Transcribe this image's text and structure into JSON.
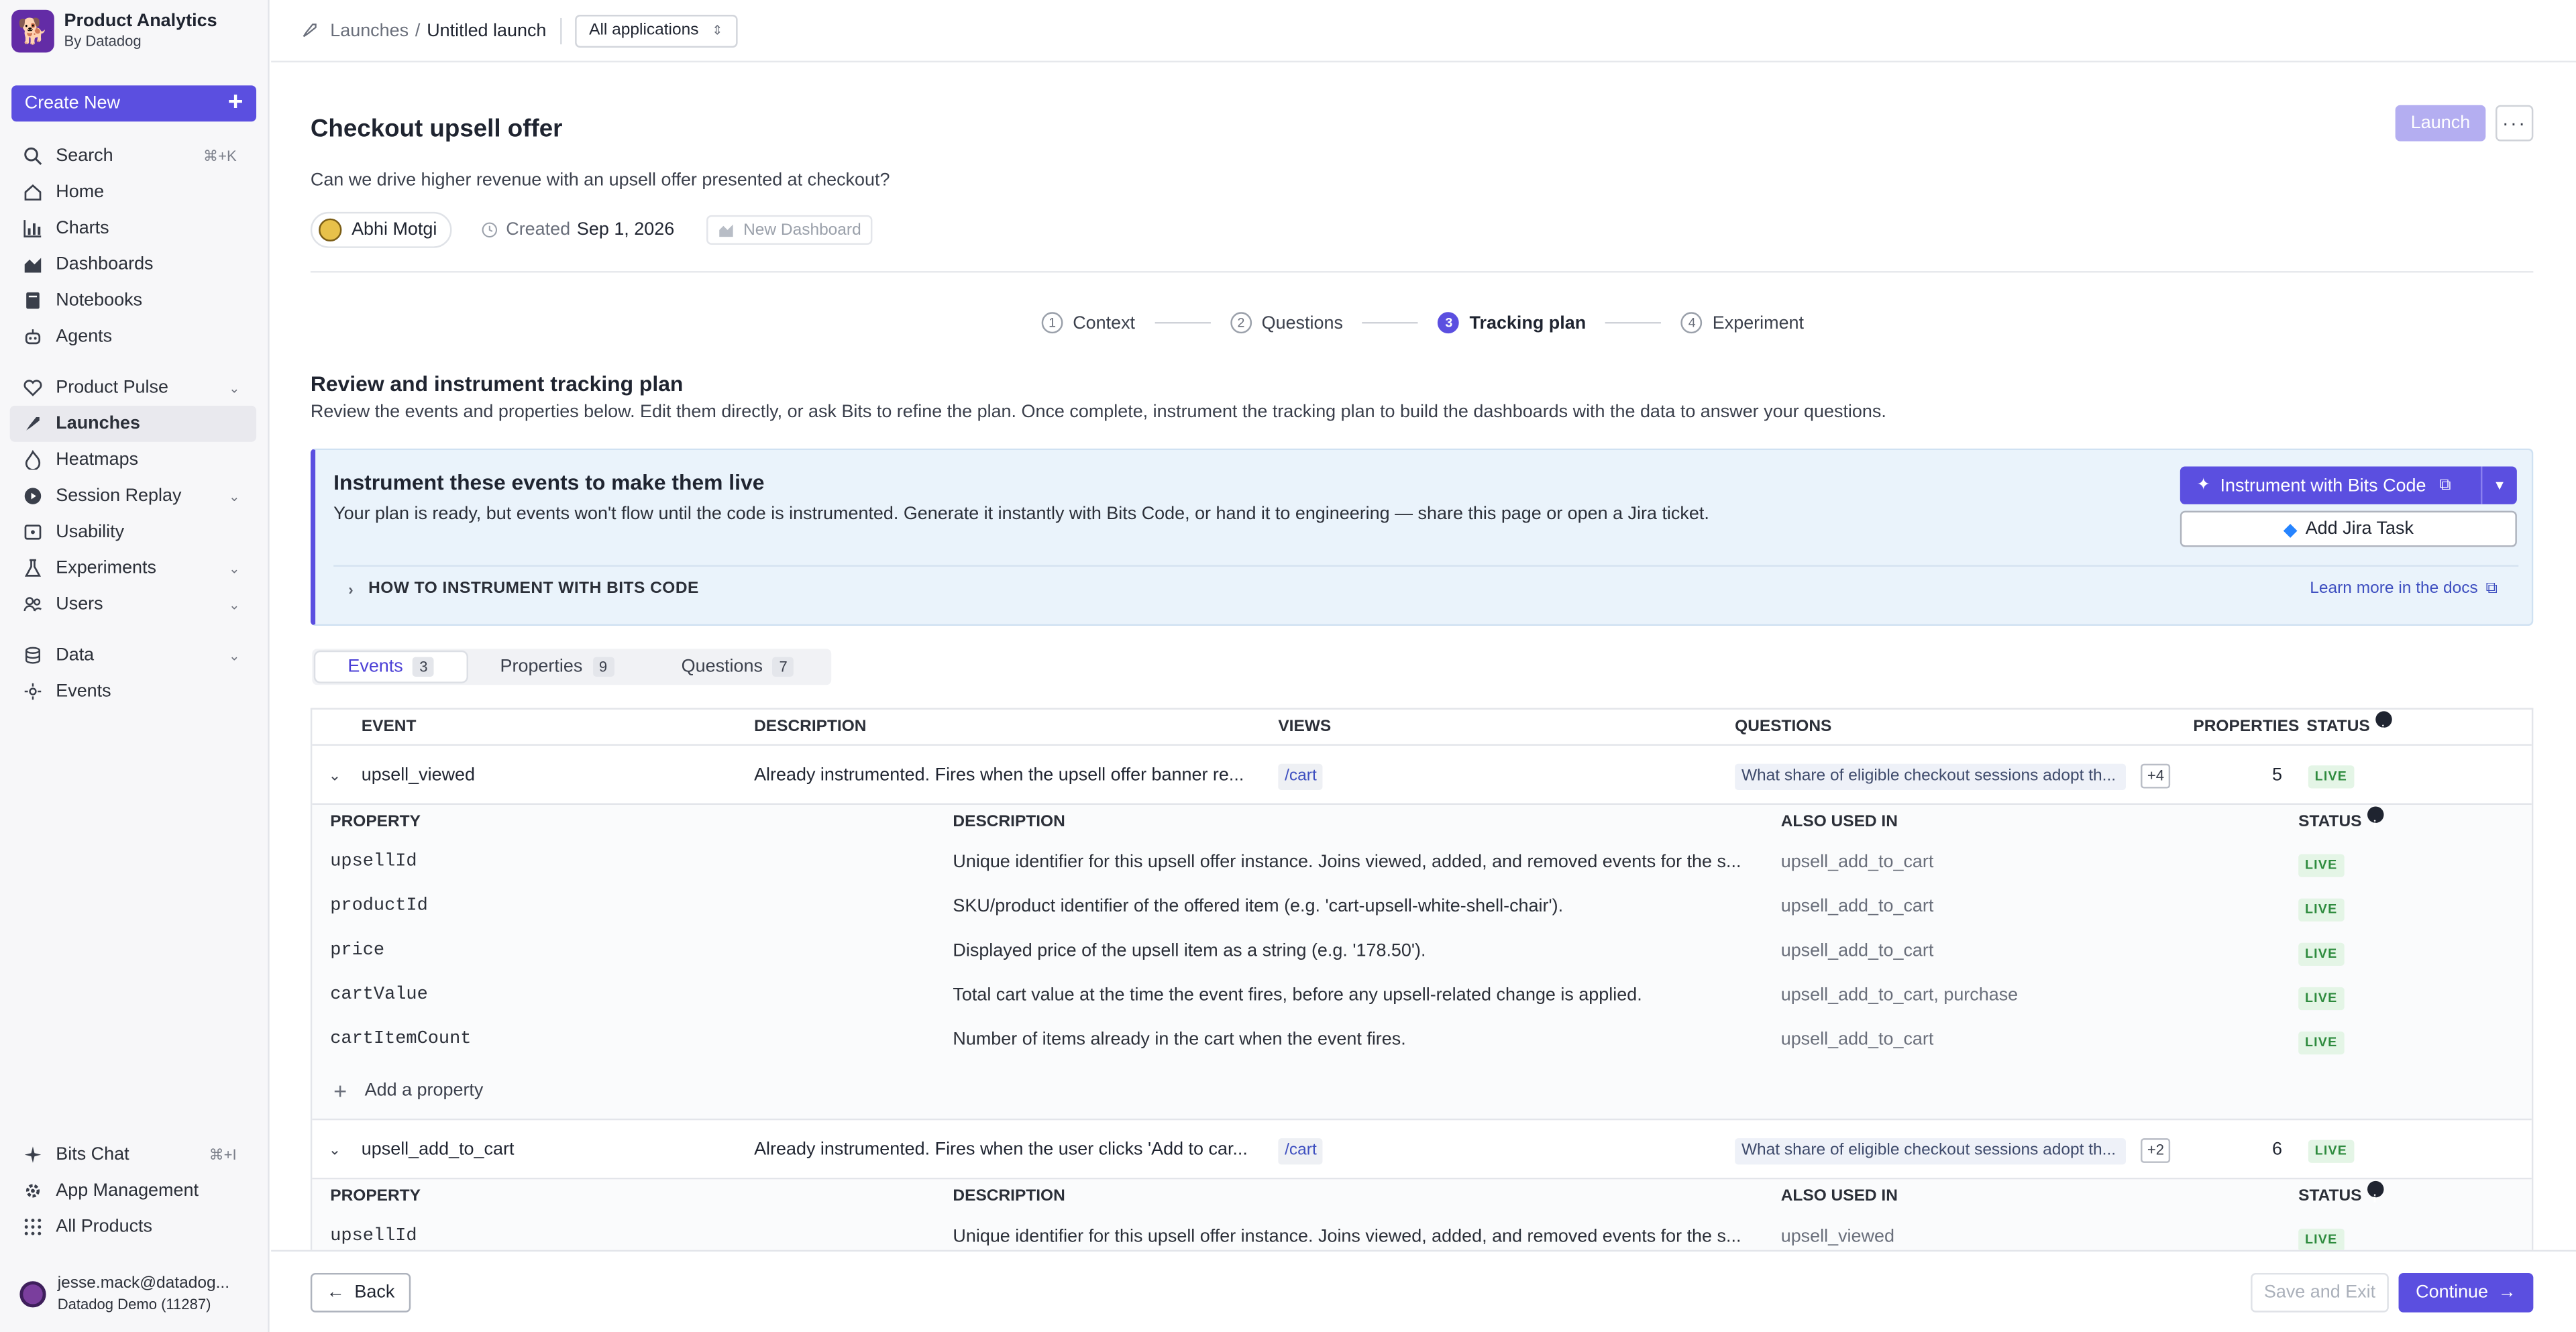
{
  "brand": {
    "title": "Product Analytics",
    "subtitle": "By Datadog"
  },
  "sidebar": {
    "create_label": "Create New",
    "items": [
      {
        "label": "Search",
        "kbd": "⌘+K"
      },
      {
        "label": "Home"
      },
      {
        "label": "Charts"
      },
      {
        "label": "Dashboards"
      },
      {
        "label": "Notebooks"
      },
      {
        "label": "Agents"
      },
      {
        "label": "Product Pulse"
      },
      {
        "label": "Launches"
      },
      {
        "label": "Heatmaps"
      },
      {
        "label": "Session Replay"
      },
      {
        "label": "Usability"
      },
      {
        "label": "Experiments"
      },
      {
        "label": "Users"
      },
      {
        "label": "Data"
      },
      {
        "label": "Events"
      },
      {
        "label": "Bits Chat",
        "kbd": "⌘+I"
      },
      {
        "label": "App Management"
      },
      {
        "label": "All Products"
      }
    ],
    "user_email": "jesse.mack@datadog...",
    "user_org": "Datadog Demo (11287)"
  },
  "topbar": {
    "crumb_parent": "Launches",
    "crumb_sep": "/",
    "crumb_current": "Untitled launch",
    "app_select": "All applications"
  },
  "header": {
    "title": "Checkout upsell offer",
    "launch_label": "Launch",
    "subtitle": "Can we drive higher revenue with an upsell offer presented at checkout?",
    "owner": "Abhi Motgi",
    "created_label": "Created",
    "created_date": "Sep 1, 2026",
    "new_dashboard": "New Dashboard"
  },
  "stepper": [
    {
      "num": "1",
      "label": "Context"
    },
    {
      "num": "2",
      "label": "Questions"
    },
    {
      "num": "3",
      "label": "Tracking plan"
    },
    {
      "num": "4",
      "label": "Experiment"
    }
  ],
  "section": {
    "title": "Review and instrument tracking plan",
    "desc": "Review the events and properties below. Edit them directly, or ask Bits to refine the plan. Once complete, instrument the tracking plan to build the dashboards with the data to answer your questions."
  },
  "banner": {
    "title": "Instrument these events to make them live",
    "desc": "Your plan is ready, but events won't flow until the code is instrumented. Generate it instantly with Bits Code, or hand it to engineering — share this page or open a Jira ticket.",
    "bits_label": "Instrument with Bits Code",
    "jira_label": "Add Jira Task",
    "howto": "HOW TO INSTRUMENT WITH BITS CODE",
    "docs": "Learn more in the docs"
  },
  "tabs": [
    {
      "label": "Events",
      "count": "3"
    },
    {
      "label": "Properties",
      "count": "9"
    },
    {
      "label": "Questions",
      "count": "7"
    }
  ],
  "table": {
    "headers": {
      "event": "EVENT",
      "description": "DESCRIPTION",
      "views": "VIEWS",
      "questions": "QUESTIONS",
      "properties": "PROPERTIES",
      "status": "STATUS"
    },
    "prop_headers": {
      "property": "PROPERTY",
      "description": "DESCRIPTION",
      "also": "ALSO USED IN",
      "status": "STATUS"
    },
    "events": [
      {
        "name": "upsell_viewed",
        "description": "Already instrumented. Fires when the upsell offer banner re...",
        "view": "/cart",
        "question": "What share of eligible checkout sessions adopt th...",
        "more": "+4",
        "properties": "5",
        "status": "LIVE",
        "props": [
          {
            "name": "upsellId",
            "description": "Unique identifier for this upsell offer instance. Joins viewed, added, and removed events for the s...",
            "also": "upsell_add_to_cart",
            "status": "LIVE"
          },
          {
            "name": "productId",
            "description": "SKU/product identifier of the offered item (e.g. 'cart-upsell-white-shell-chair').",
            "also": "upsell_add_to_cart",
            "status": "LIVE"
          },
          {
            "name": "price",
            "description": "Displayed price of the upsell item as a string (e.g. '178.50').",
            "also": "upsell_add_to_cart",
            "status": "LIVE"
          },
          {
            "name": "cartValue",
            "description": "Total cart value at the time the event fires, before any upsell-related change is applied.",
            "also": "upsell_add_to_cart, purchase",
            "status": "LIVE"
          },
          {
            "name": "cartItemCount",
            "description": "Number of items already in the cart when the event fires.",
            "also": "upsell_add_to_cart",
            "status": "LIVE"
          }
        ],
        "add_property": "Add a property"
      },
      {
        "name": "upsell_add_to_cart",
        "description": "Already instrumented. Fires when the user clicks 'Add to car...",
        "view": "/cart",
        "question": "What share of eligible checkout sessions adopt th...",
        "more": "+2",
        "properties": "6",
        "status": "LIVE",
        "props": [
          {
            "name": "upsellId",
            "description": "Unique identifier for this upsell offer instance. Joins viewed, added, and removed events for the s...",
            "also": "upsell_viewed",
            "status": "LIVE"
          }
        ]
      }
    ]
  },
  "footer": {
    "back": "Back",
    "save": "Save and Exit",
    "continue": "Continue"
  }
}
